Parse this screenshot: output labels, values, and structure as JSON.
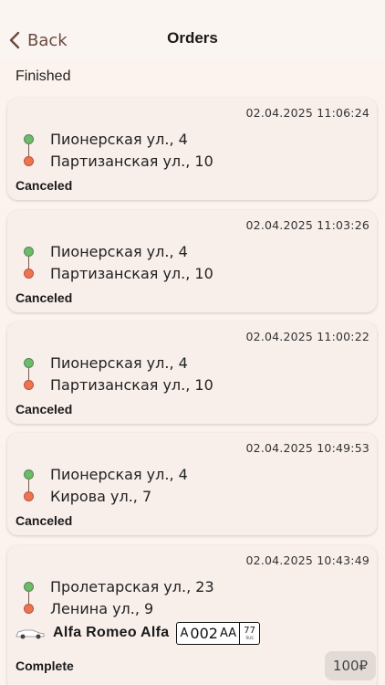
{
  "header": {
    "back_label": "Back",
    "title": "Orders"
  },
  "section_label": "Finished",
  "orders": [
    {
      "timestamp": "02.04.2025 11:06:24",
      "from": "Пионерская ул., 4",
      "to": "Партизанская ул., 10",
      "status": "Canceled"
    },
    {
      "timestamp": "02.04.2025 11:03:26",
      "from": "Пионерская ул., 4",
      "to": "Партизанская ул., 10",
      "status": "Canceled"
    },
    {
      "timestamp": "02.04.2025 11:00:22",
      "from": "Пионерская ул., 4",
      "to": "Партизанская ул., 10",
      "status": "Canceled"
    },
    {
      "timestamp": "02.04.2025 10:49:53",
      "from": "Пионерская ул., 4",
      "to": "Кирова ул., 7",
      "status": "Canceled"
    },
    {
      "timestamp": "02.04.2025 10:43:49",
      "from": "Пролетарская ул., 23",
      "to": "Ленина ул., 9",
      "status": "Complete",
      "car": {
        "name": "Alfa Romeo Alfa",
        "plate_letter1": "A",
        "plate_digits": "002",
        "plate_letters": "AA",
        "plate_region": "77",
        "plate_country": "RUS"
      },
      "price": "100₽"
    }
  ],
  "colors": {
    "from_dot": "#6fb96a",
    "to_dot": "#f0734f",
    "accent": "#6b4a3e",
    "card_bg": "#f8efeb"
  },
  "icons": {
    "back": "chevron-left-icon",
    "car": "car-icon",
    "from": "origin-dot-icon",
    "to": "destination-dot-icon"
  }
}
